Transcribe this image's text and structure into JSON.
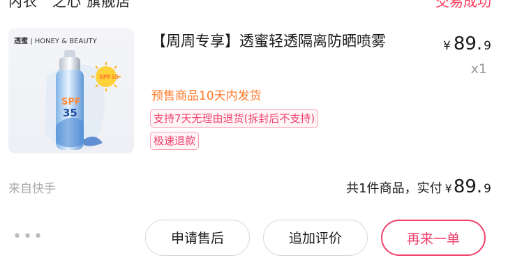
{
  "order": {
    "store_name": "内衣　之心 旗舰店",
    "status": "交易成功"
  },
  "product": {
    "brand_logo_text": "透蜜",
    "brand_tagline": "| HONEY & BEAUTY",
    "title": "【周周专享】透蜜轻透隔离防晒喷雾",
    "price_symbol": "¥",
    "price_integer": "89.",
    "price_decimal": "9",
    "quantity": "x1",
    "presale_note": "预售商品10天内发货",
    "tags": [
      "支持7天无理由退货(拆封后不支持)",
      "极速退款"
    ],
    "spf_label": "SPF 35"
  },
  "footer": {
    "source": "来自快手",
    "summary_prefix": "共1件商品，实付",
    "total_symbol": "¥",
    "total_integer": "89.",
    "total_decimal": "9"
  },
  "actions": {
    "more": "•••",
    "after_sale": "申请售后",
    "add_review": "追加评价",
    "reorder": "再来一单"
  },
  "colors": {
    "accent": "#f0416a",
    "presale": "#ff7a2a",
    "muted": "#aaaaaa"
  }
}
